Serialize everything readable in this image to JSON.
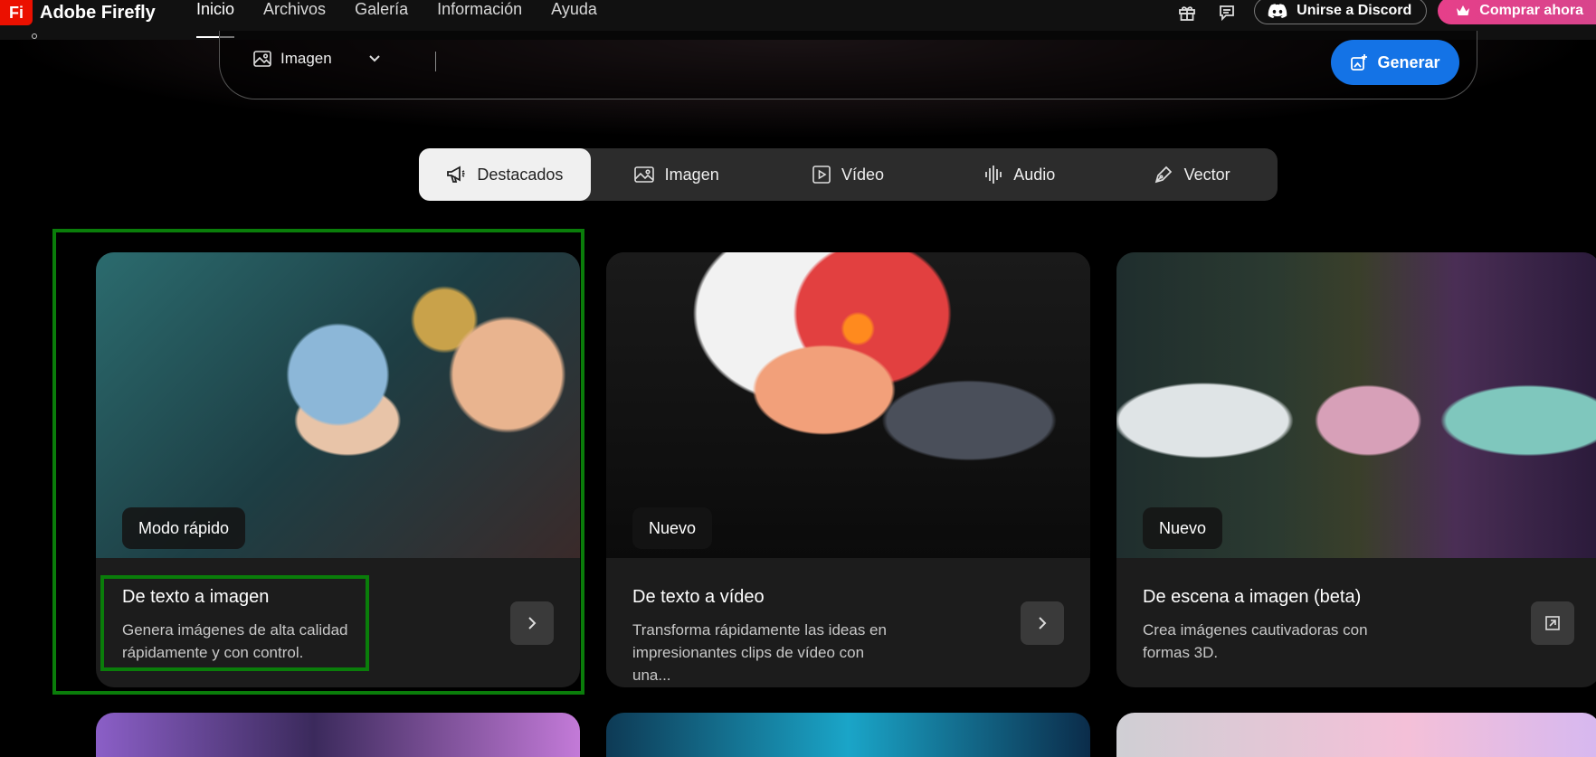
{
  "header": {
    "logo_mark": "Fi",
    "app_name": "Adobe Firefly",
    "nav": [
      "Inicio",
      "Archivos",
      "Galería",
      "Información",
      "Ayuda"
    ],
    "active_nav": "Inicio",
    "discord_label": "Unirse a Discord",
    "buy_label": "Comprar ahora",
    "icons": [
      "gift-icon",
      "feedback-icon"
    ]
  },
  "prompt": {
    "type_label": "Imagen",
    "generate_label": "Generar"
  },
  "tabs": [
    {
      "label": "Destacados",
      "icon": "megaphone-icon",
      "active": true
    },
    {
      "label": "Imagen",
      "icon": "image-icon",
      "active": false
    },
    {
      "label": "Vídeo",
      "icon": "video-icon",
      "active": false
    },
    {
      "label": "Audio",
      "icon": "audio-icon",
      "active": false
    },
    {
      "label": "Vector",
      "icon": "pen-icon",
      "active": false
    }
  ],
  "cards": [
    {
      "badge": "Modo rápido",
      "title": "De texto a imagen",
      "desc": "Genera imágenes de alta calidad rápidamente y con control.",
      "action_icon": "chevron-right-icon"
    },
    {
      "badge": "Nuevo",
      "title": "De texto a vídeo",
      "desc": "Transforma rápidamente las ideas en impresionantes clips de vídeo con una...",
      "action_icon": "chevron-right-icon"
    },
    {
      "badge": "Nuevo",
      "title": "De escena a imagen (beta)",
      "desc": "Crea imágenes cautivadoras con formas 3D.",
      "action_icon": "open-external-icon"
    }
  ],
  "colors": {
    "accent": "#1473e6",
    "brand": "#eb1000",
    "buy": "#e63f8a",
    "highlight": "#0a7d0a"
  }
}
